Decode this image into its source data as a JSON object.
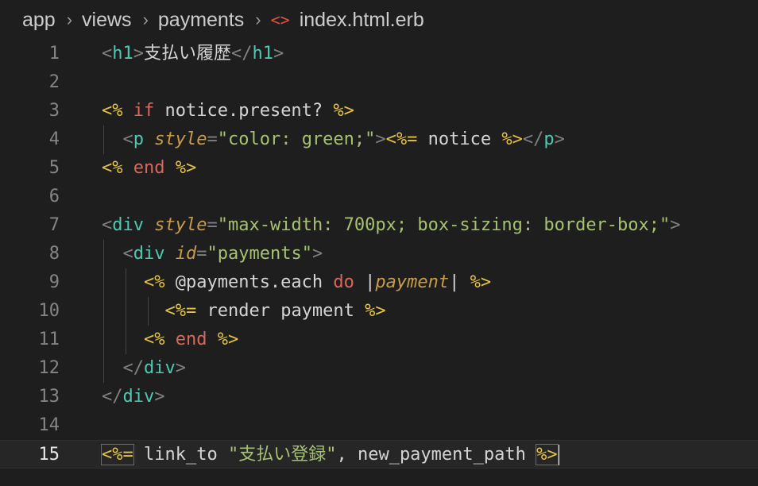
{
  "breadcrumb": {
    "items": [
      "app",
      "views",
      "payments"
    ],
    "separator": "›",
    "file_icon": "<>",
    "file": "index.html.erb"
  },
  "editor": {
    "current_line": 15,
    "lines": [
      {
        "n": "1",
        "tokens": [
          [
            "<",
            "t"
          ],
          [
            "h1",
            "tn"
          ],
          [
            ">",
            "t"
          ],
          [
            "支払い履歴",
            "pl"
          ],
          [
            "</",
            "t"
          ],
          [
            "h1",
            "tn"
          ],
          [
            ">",
            "t"
          ]
        ]
      },
      {
        "n": "2",
        "tokens": []
      },
      {
        "n": "3",
        "tokens": [
          [
            "<%",
            "pc"
          ],
          [
            " ",
            "pl"
          ],
          [
            "if",
            "kw"
          ],
          [
            " notice.present? ",
            "pl"
          ],
          [
            "%>",
            "pc"
          ]
        ]
      },
      {
        "n": "4",
        "tokens": [
          [
            "  ",
            "pl"
          ],
          [
            "<",
            "t"
          ],
          [
            "p",
            "tn"
          ],
          [
            " ",
            "pl"
          ],
          [
            "style",
            "at"
          ],
          [
            "=",
            "t"
          ],
          [
            "\"color: green;\"",
            "st"
          ],
          [
            ">",
            "t"
          ],
          [
            "<%=",
            "pc"
          ],
          [
            " notice ",
            "pl"
          ],
          [
            "%>",
            "pc"
          ],
          [
            "</",
            "t"
          ],
          [
            "p",
            "tn"
          ],
          [
            ">",
            "t"
          ]
        ]
      },
      {
        "n": "5",
        "tokens": [
          [
            "<%",
            "pc"
          ],
          [
            " ",
            "pl"
          ],
          [
            "end",
            "kw"
          ],
          [
            " ",
            "pl"
          ],
          [
            "%>",
            "pc"
          ]
        ]
      },
      {
        "n": "6",
        "tokens": []
      },
      {
        "n": "7",
        "tokens": [
          [
            "<",
            "t"
          ],
          [
            "div",
            "tn"
          ],
          [
            " ",
            "pl"
          ],
          [
            "style",
            "at"
          ],
          [
            "=",
            "t"
          ],
          [
            "\"max-width: 700px; box-sizing: border-box;\"",
            "st"
          ],
          [
            ">",
            "t"
          ]
        ]
      },
      {
        "n": "8",
        "tokens": [
          [
            "  ",
            "pl"
          ],
          [
            "<",
            "t"
          ],
          [
            "div",
            "tn"
          ],
          [
            " ",
            "pl"
          ],
          [
            "id",
            "at"
          ],
          [
            "=",
            "t"
          ],
          [
            "\"payments\"",
            "st"
          ],
          [
            ">",
            "t"
          ]
        ]
      },
      {
        "n": "9",
        "tokens": [
          [
            "    ",
            "pl"
          ],
          [
            "<%",
            "pc"
          ],
          [
            " @payments.each ",
            "pl"
          ],
          [
            "do",
            "kw"
          ],
          [
            " |",
            "pl"
          ],
          [
            "payment",
            "at"
          ],
          [
            "| ",
            "pl"
          ],
          [
            "%>",
            "pc"
          ]
        ]
      },
      {
        "n": "10",
        "tokens": [
          [
            "      ",
            "pl"
          ],
          [
            "<%=",
            "pc"
          ],
          [
            " render payment ",
            "pl"
          ],
          [
            "%>",
            "pc"
          ]
        ]
      },
      {
        "n": "11",
        "tokens": [
          [
            "    ",
            "pl"
          ],
          [
            "<%",
            "pc"
          ],
          [
            " ",
            "pl"
          ],
          [
            "end",
            "kw"
          ],
          [
            " ",
            "pl"
          ],
          [
            "%>",
            "pc"
          ]
        ]
      },
      {
        "n": "12",
        "tokens": [
          [
            "  ",
            "pl"
          ],
          [
            "</",
            "t"
          ],
          [
            "div",
            "tn"
          ],
          [
            ">",
            "t"
          ]
        ]
      },
      {
        "n": "13",
        "tokens": [
          [
            "</",
            "t"
          ],
          [
            "div",
            "tn"
          ],
          [
            ">",
            "t"
          ]
        ]
      },
      {
        "n": "14",
        "tokens": []
      },
      {
        "n": "15",
        "tokens": [
          [
            "<%=",
            "pc bx"
          ],
          [
            " link_to ",
            "pl"
          ],
          [
            "\"支払い登録\"",
            "st"
          ],
          [
            ", new_payment_path ",
            "pl"
          ],
          [
            "%>",
            "pc bx"
          ]
        ]
      }
    ]
  }
}
